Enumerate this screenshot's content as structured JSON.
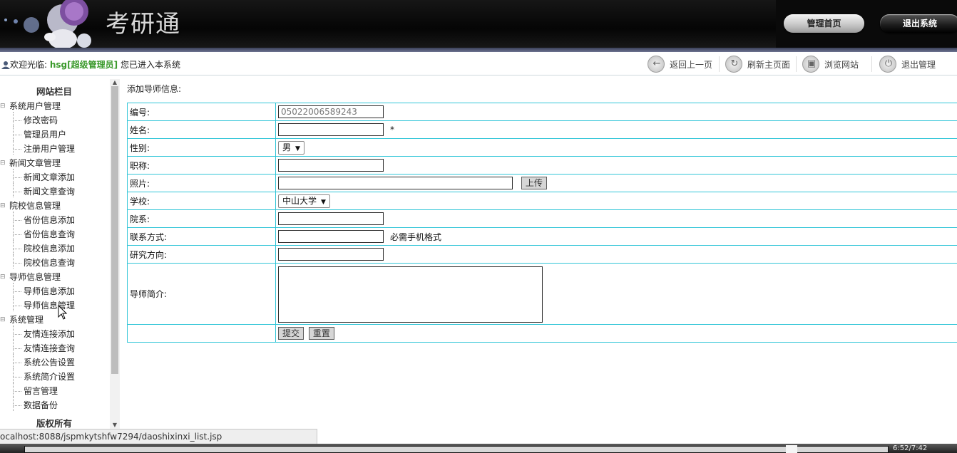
{
  "header": {
    "site_title": "考研通",
    "home_button": "管理首页",
    "logout_button": "退出系统"
  },
  "topbar": {
    "welcome_prefix": "欢迎光临:",
    "username": "hsg[超级管理员]",
    "welcome_suffix": "您已进入本系统",
    "back_label": "返回上一页",
    "refresh_label": "刷新主页面",
    "browse_label": "浏览网站",
    "exit_label": "退出管理"
  },
  "sidebar": {
    "title": "网站栏目",
    "footer": "版权所有",
    "groups": [
      {
        "label": "系统用户管理",
        "items": [
          "修改密码",
          "管理员用户",
          "注册用户管理"
        ]
      },
      {
        "label": "新闻文章管理",
        "items": [
          "新闻文章添加",
          "新闻文章查询"
        ]
      },
      {
        "label": "院校信息管理",
        "items": [
          "省份信息添加",
          "省份信息查询",
          "院校信息添加",
          "院校信息查询"
        ]
      },
      {
        "label": "导师信息管理",
        "items": [
          "导师信息添加",
          "导师信息管理"
        ]
      },
      {
        "label": "系统管理",
        "items": [
          "友情连接添加",
          "友情连接查询",
          "系统公告设置",
          "系统简介设置",
          "留言管理",
          "数据备份"
        ]
      }
    ]
  },
  "form": {
    "heading": "添加导师信息:",
    "labels": {
      "id": "编号:",
      "name": "姓名:",
      "gender": "性别:",
      "title": "职称:",
      "photo": "照片:",
      "school": "学校:",
      "dept": "院系:",
      "contact": "联系方式:",
      "research": "研究方向:",
      "intro": "导师简介:"
    },
    "values": {
      "id": "05022006589243",
      "gender": "男",
      "school": "中山大学"
    },
    "required_mark": "*",
    "contact_hint": "必需手机格式",
    "upload_button": "上传",
    "submit_button": "提交",
    "reset_button": "重置"
  },
  "status_bar": {
    "url": "ocalhost:8088/jspmkytshfw7294/daoshixinxi_list.jsp"
  },
  "taskbar": {
    "time": "6:52/7:42"
  },
  "colors": {
    "accent_border": "#33c6d8",
    "username_green": "#3b9a2c"
  }
}
